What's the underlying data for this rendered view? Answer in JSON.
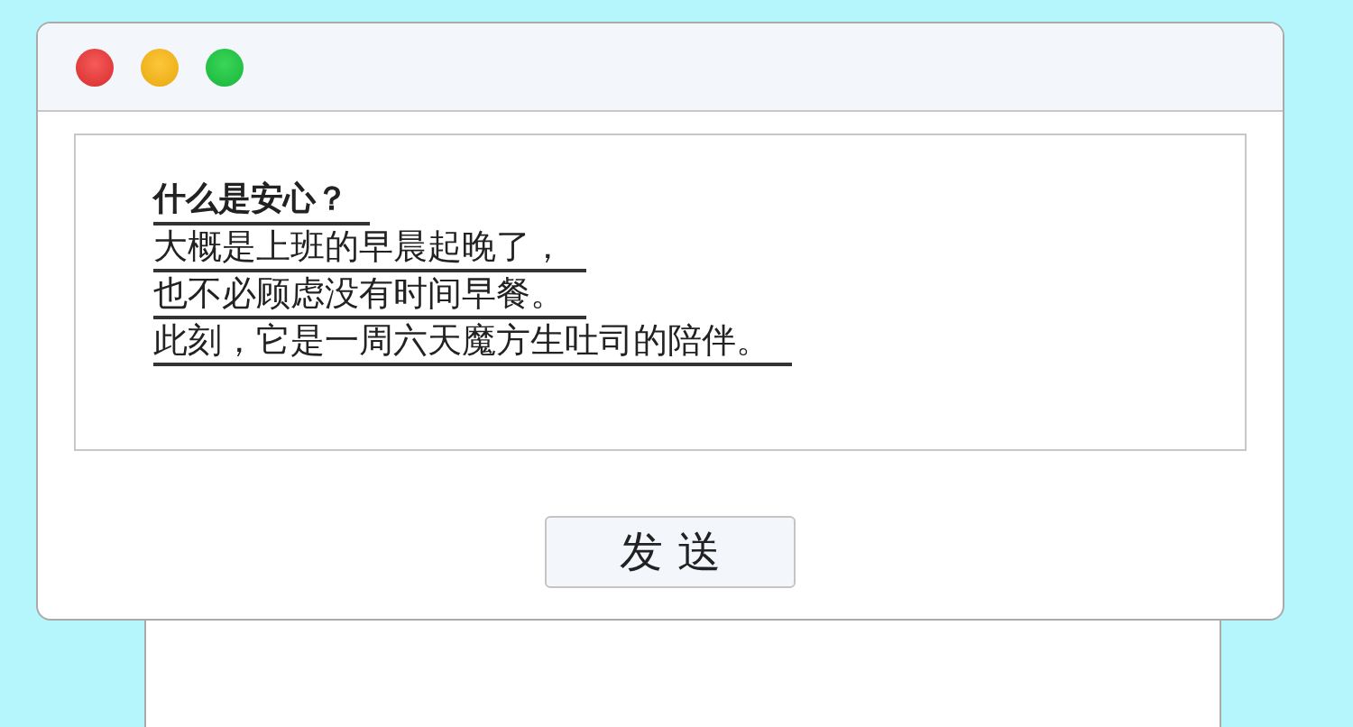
{
  "message": {
    "title": "什么是安心？",
    "lines": [
      "大概是上班的早晨起晚了，",
      "也不必顾虑没有时间早餐。",
      "此刻，它是一周六天魔方生吐司的陪伴。"
    ]
  },
  "send_button": {
    "label": "发 送"
  }
}
